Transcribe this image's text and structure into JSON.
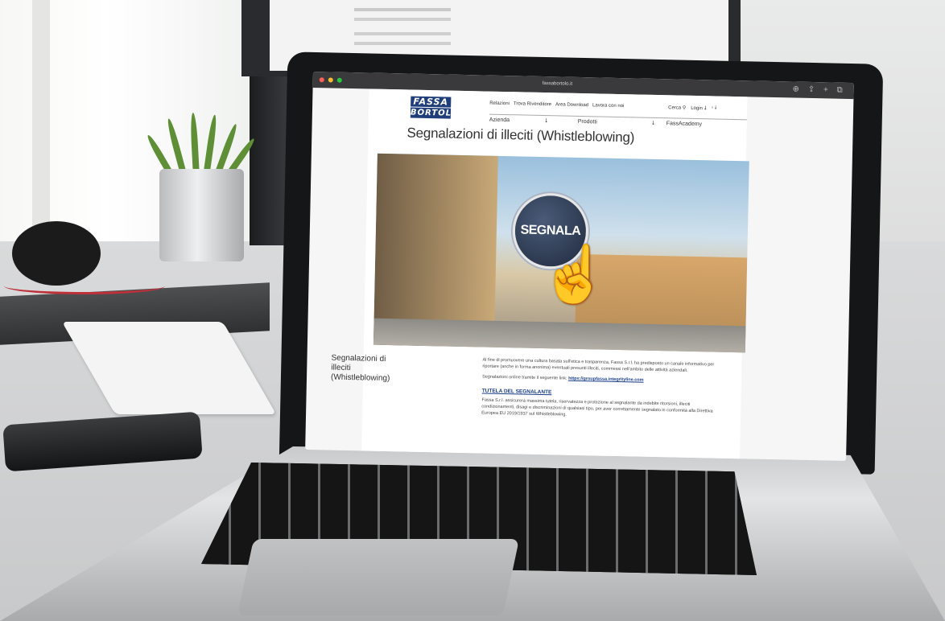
{
  "browser": {
    "url": "fassabortolo.it"
  },
  "site": {
    "logo_line1": "FASSA",
    "logo_line2": "BORTOLO",
    "top_links": [
      "Relazioni",
      "Trova Rivenditore",
      "Area Download",
      "Lavora con noi"
    ],
    "search_label": "Cerca",
    "login_label": "Login",
    "menu": [
      "Azienda",
      "Prodotti",
      "FassAcademy"
    ],
    "page_title": "Segnalazioni di illeciti (Whistleblowing)",
    "hero_button": "SEGNALA",
    "section_title": "Segnalazioni di illeciti (Whistleblowing)",
    "intro": "Al fine di promuovere una cultura basata sull'etica e trasparenza, Fassa S.r.l. ha predisposto un canale informativo per riportare (anche in forma anonima) eventuali presunti illeciti, commessi nell'ambito delle attività aziendali.",
    "link_prefix": "Segnalazioni online tramite il seguente link:",
    "link_text": "https://groupfassa.integrityline.com",
    "subheading": "TUTELA DEL SEGNALANTE",
    "tutela_text": "Fassa S.r.l. assicurerà massima tutela, riservatezza e protezione al segnalante da indebite ritorsioni, illeciti condizionamenti, disagi e discriminazioni di qualsiasi tipo, per aver correttamente segnalato in conformità alla Direttiva Europea EU 2019/1937 sul Whistleblowing."
  }
}
